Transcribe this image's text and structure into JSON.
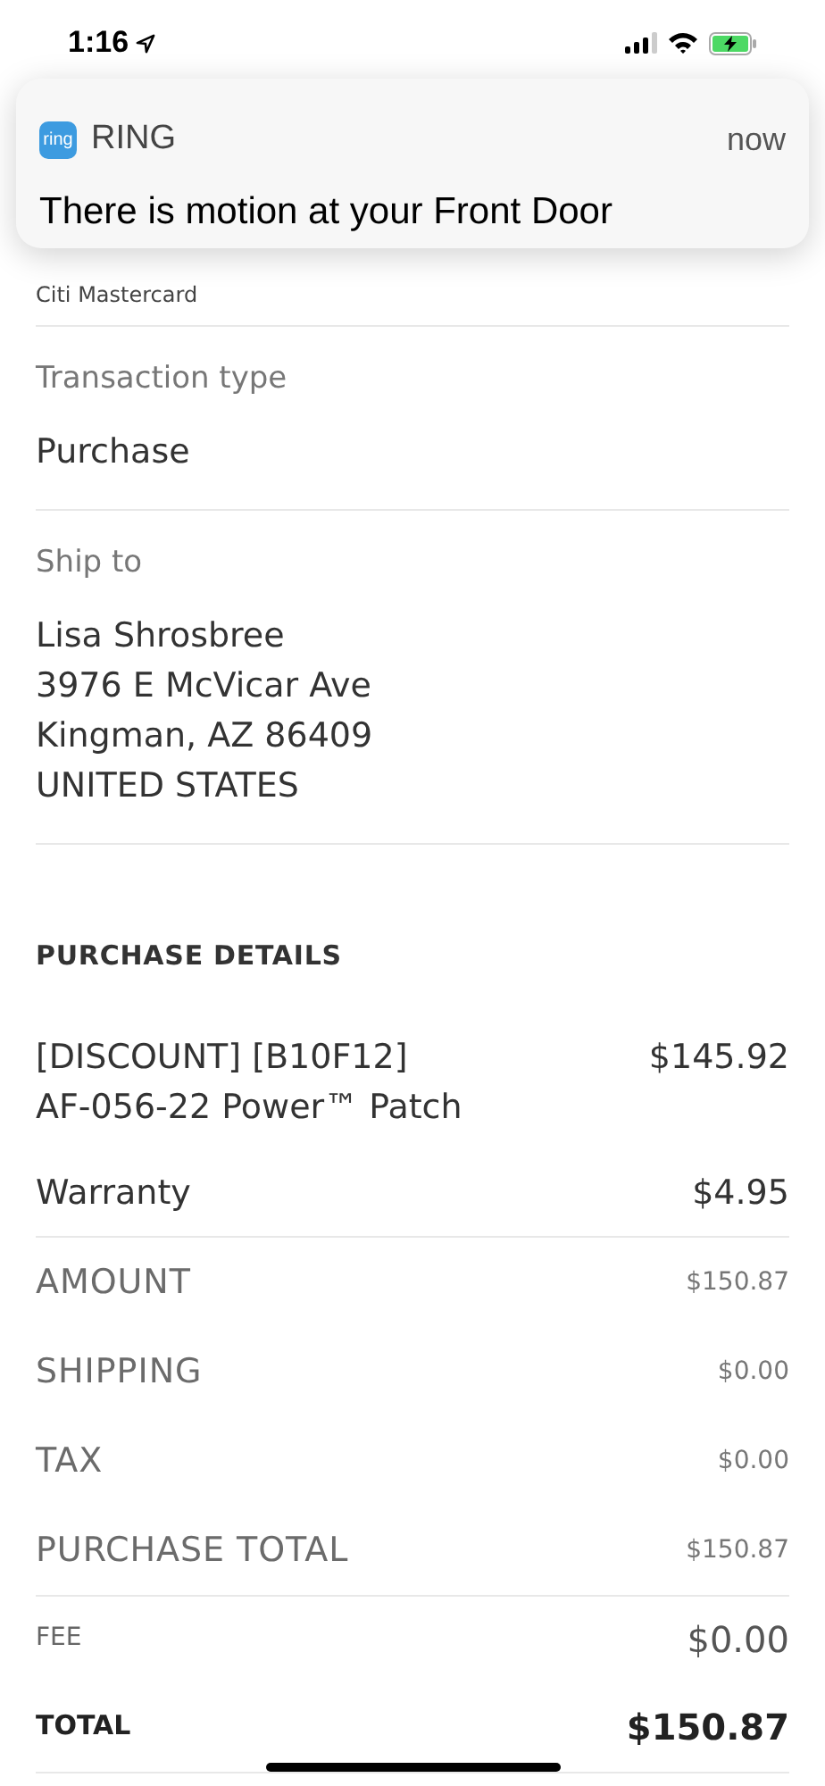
{
  "status_bar": {
    "time": "1:16"
  },
  "notification": {
    "app": "RING",
    "icon_text": "ring",
    "time": "now",
    "message": "There is motion at your Front Door"
  },
  "payment": {
    "card_subtitle": "Citi Mastercard"
  },
  "transaction": {
    "label": "Transaction type",
    "value": "Purchase"
  },
  "ship_to": {
    "label": "Ship to",
    "lines": [
      "Lisa Shrosbree",
      "3976 E McVicar Ave",
      "Kingman, AZ 86409",
      "UNITED STATES"
    ]
  },
  "purchase_details": {
    "title": "PURCHASE DETAILS",
    "items": [
      {
        "name": "[DISCOUNT] [B10F12]\nAF-056-22 Power™ Patch",
        "price": "$145.92"
      },
      {
        "name": "Warranty",
        "price": "$4.95"
      }
    ]
  },
  "totals": [
    {
      "kind": "charge",
      "label": "AMOUNT",
      "value": "$150.87"
    },
    {
      "kind": "charge",
      "label": "SHIPPING",
      "value": "$0.00"
    },
    {
      "kind": "charge",
      "label": "TAX",
      "value": "$0.00"
    },
    {
      "kind": "charge",
      "label": "PURCHASE TOTAL",
      "value": "$150.87"
    },
    {
      "kind": "fee",
      "label": "FEE",
      "value": "$0.00"
    },
    {
      "kind": "total",
      "label": "TOTAL",
      "value": "$150.87"
    }
  ]
}
